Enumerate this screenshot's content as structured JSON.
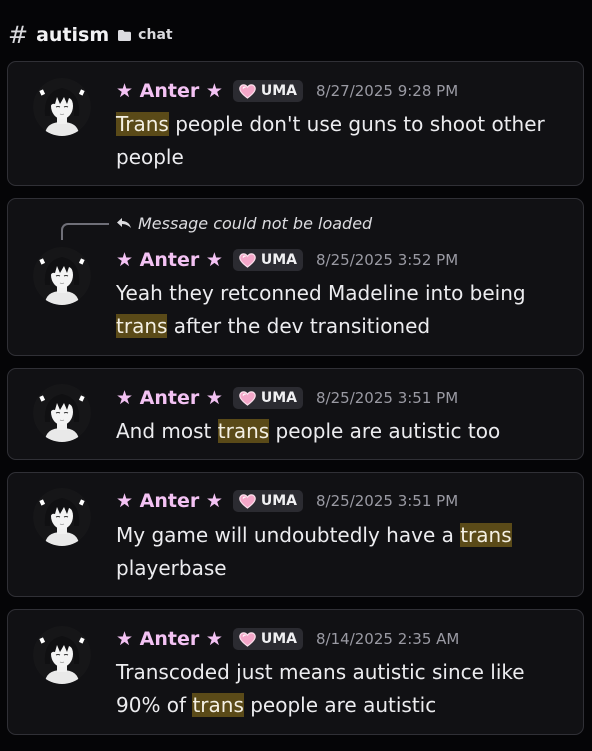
{
  "channel": {
    "hash": "#",
    "name": "autism",
    "sub_label": "chat"
  },
  "tag_label": "UMA",
  "author_name": "★ Anter ★",
  "reply_text": "Message could not be loaded",
  "messages": [
    {
      "time": "8/27/2025 9:28 PM",
      "parts": [
        {
          "t": "Trans",
          "hl": true
        },
        {
          "t": " people don't use guns to shoot other people"
        }
      ]
    },
    {
      "time": "8/25/2025 3:52 PM",
      "parts": [
        {
          "t": "Yeah they retconned Madeline into being "
        },
        {
          "t": "trans",
          "hl": true
        },
        {
          "t": " after the dev transitioned"
        }
      ]
    },
    {
      "time": "8/25/2025 3:51 PM",
      "parts": [
        {
          "t": "And most "
        },
        {
          "t": "trans",
          "hl": true
        },
        {
          "t": " people are autistic too"
        }
      ]
    },
    {
      "time": "8/25/2025 3:51 PM",
      "parts": [
        {
          "t": "My game will undoubtedly have a "
        },
        {
          "t": "trans",
          "hl": true
        },
        {
          "t": " playerbase"
        }
      ]
    },
    {
      "time": "8/14/2025 2:35 AM",
      "parts": [
        {
          "t": "Transcoded just means autistic since like 90% of "
        },
        {
          "t": "trans",
          "hl": true
        },
        {
          "t": " people are autistic"
        }
      ]
    }
  ],
  "colors": {
    "background": "#050507",
    "card": "#111114",
    "name": "#f3c2f3",
    "highlight": "#5a4a18"
  },
  "icons": {
    "folder": "folder-icon",
    "heart": "heart-icon",
    "reply": "reply-arrow-icon"
  }
}
